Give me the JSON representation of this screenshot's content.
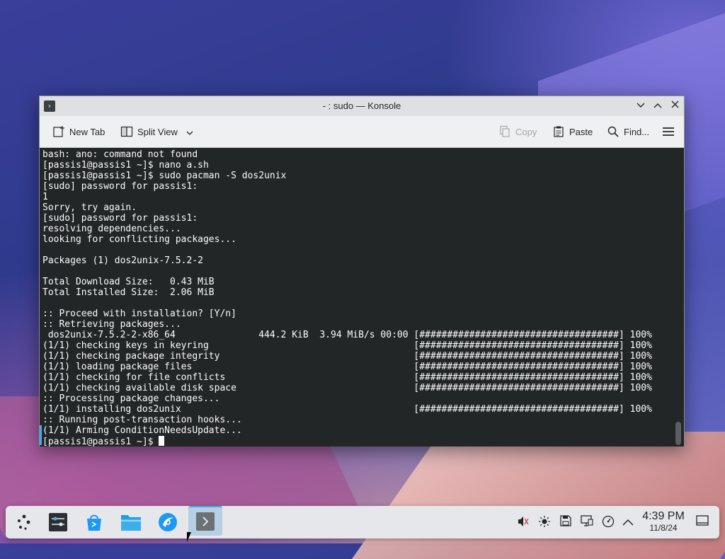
{
  "window": {
    "title": "- : sudo — Konsole",
    "app_icon": "terminal-icon",
    "controls": {
      "minimize": "﹀",
      "maximize": "︿",
      "close": "✕"
    }
  },
  "toolbar": {
    "new_tab_label": "New Tab",
    "split_view_label": "Split View",
    "copy_label": "Copy",
    "paste_label": "Paste",
    "find_label": "Find...",
    "menu_icon": "hamburger-menu-icon"
  },
  "terminal": {
    "lines": [
      "bash: ano: command not found",
      "[passis1@passis1 ~]$ nano a.sh",
      "[passis1@passis1 ~]$ sudo pacman -S dos2unix",
      "[sudo] password for passis1:",
      "1",
      "Sorry, try again.",
      "[sudo] password for passis1:",
      "resolving dependencies...",
      "looking for conflicting packages...",
      "",
      "Packages (1) dos2unix-7.5.2-2",
      "",
      "Total Download Size:   0.43 MiB",
      "Total Installed Size:  2.06 MiB",
      "",
      ":: Proceed with installation? [Y/n]",
      ":: Retrieving packages...",
      " dos2unix-7.5.2-2-x86_64               444.2 KiB  3.94 MiB/s 00:00 [####################################] 100%",
      "(1/1) checking keys in keyring                                     [####################################] 100%",
      "(1/1) checking package integrity                                   [####################################] 100%",
      "(1/1) loading package files                                        [####################################] 100%",
      "(1/1) checking for file conflicts                                  [####################################] 100%",
      "(1/1) checking available disk space                                [####################################] 100%",
      ":: Processing package changes...",
      "(1/1) installing dos2unix                                          [####################################] 100%",
      ":: Running post-transaction hooks...",
      "(1/1) Arming ConditionNeedsUpdate...",
      "[passis1@passis1 ~]$ "
    ],
    "background": "#232627",
    "foreground": "#fcfcfc"
  },
  "taskbar": {
    "launcher_icon": "application-launcher-icon",
    "apps": [
      {
        "name": "system-settings-icon"
      },
      {
        "name": "discover-store-icon"
      },
      {
        "name": "dolphin-file-manager-icon"
      },
      {
        "name": "browser-icon"
      },
      {
        "name": "konsole-terminal-icon",
        "active": true
      }
    ],
    "tray": [
      "volume-muted-icon",
      "brightness-icon",
      "save-icon",
      "display-icon",
      "network-icon",
      "expand-tray-icon"
    ],
    "clock": {
      "time": "4:39 PM",
      "date": "11/8/24"
    },
    "show_desktop_icon": "show-desktop-icon"
  }
}
